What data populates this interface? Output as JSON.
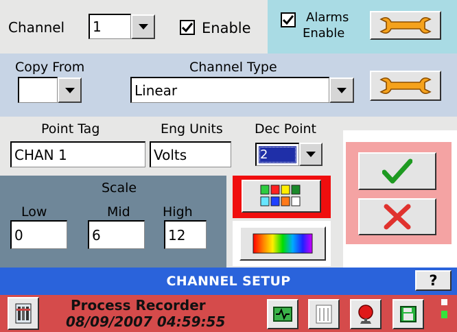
{
  "channel": {
    "label": "Channel",
    "value": "1"
  },
  "enable": {
    "label": "Enable",
    "checked": true
  },
  "alarms": {
    "line1": "Alarms",
    "line2": "Enable",
    "checked": true
  },
  "copy_from": {
    "label": "Copy From",
    "value": ""
  },
  "channel_type": {
    "label": "Channel Type",
    "value": "Linear"
  },
  "point_tag": {
    "label": "Point Tag",
    "value": "CHAN 1"
  },
  "eng_units": {
    "label": "Eng Units",
    "value": "Volts"
  },
  "dec_point": {
    "label": "Dec Point",
    "value": "2"
  },
  "scale": {
    "label": "Scale",
    "low_label": "Low",
    "mid_label": "Mid",
    "high_label": "High",
    "low": "0",
    "mid": "6",
    "high": "12"
  },
  "title": {
    "text": "CHANNEL SETUP",
    "help": "?"
  },
  "status": {
    "app_name": "Process Recorder",
    "datetime": "08/09/2007 04:59:55"
  },
  "colors": {
    "accent_blue": "#2a63db",
    "status_red": "#d54b4b",
    "confirm_green": "#1e9a21",
    "cancel_red": "#e0322e",
    "palette": [
      "#2ecc40",
      "#ff2020",
      "#ffee00",
      "#1b8a2b",
      "#66e6ff",
      "#2040ff",
      "#ff7a1a",
      "#ffffff"
    ]
  },
  "icons": {
    "wrench": "wrench-icon",
    "check": "checkmark-icon",
    "cancel": "x-icon",
    "palette": "color-palette-icon",
    "gradient": "color-gradient-icon",
    "tools": "tools-icon",
    "recorder": "recorder-icon",
    "list": "list-icon",
    "alarm": "alarm-icon",
    "save": "save-icon"
  }
}
